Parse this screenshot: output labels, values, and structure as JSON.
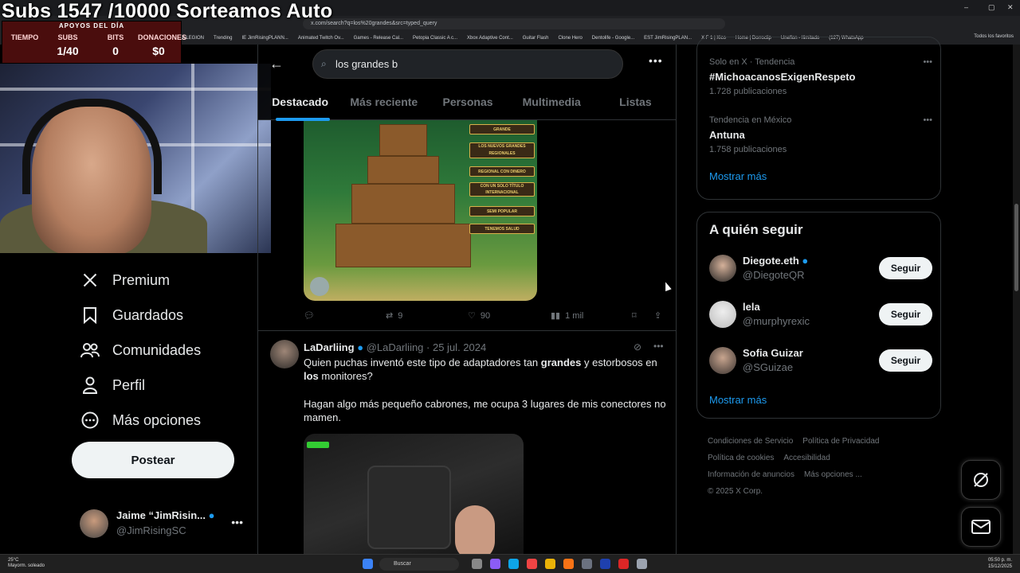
{
  "browser": {
    "url": "x.com/search?q=los%20grandes&src=typed_query",
    "bookmarks": [
      "A LEGION",
      "Trending",
      "IE JimRisingPLANN...",
      "Animated Twitch Ov...",
      "Games - Release Cal...",
      "Petopia Classic A c...",
      "Xbox Adaptive Cont...",
      "Guitar Flash",
      "Clone Hero",
      "Dentolife - Google...",
      "EST JimRisingPLAN...",
      "X F 1 | Xico",
      "Home | Dorroclip",
      "Uneflon - Ilimitado",
      "(127) WhatsApp"
    ],
    "all_bookmarks": "Todos los favoritos"
  },
  "overlay": {
    "title": "Subs 1547 /10000 Sorteamos Auto",
    "header": "APOYOS DEL DÍA",
    "counters": [
      {
        "label": "TIEMPO",
        "value": ""
      },
      {
        "label": "SUBS",
        "value": "1/40"
      },
      {
        "label": "BITS",
        "value": "0"
      },
      {
        "label": "DONACIONES",
        "value": "$0"
      }
    ]
  },
  "sidenav": {
    "items": [
      {
        "label": "Premium",
        "icon": "x-logo-icon"
      },
      {
        "label": "Guardados",
        "icon": "bookmark-icon"
      },
      {
        "label": "Comunidades",
        "icon": "communities-icon"
      },
      {
        "label": "Perfil",
        "icon": "person-icon"
      },
      {
        "label": "Más opciones",
        "icon": "more-circle-icon"
      }
    ],
    "post_label": "Postear",
    "account": {
      "name": "Jaime “JimRisin...",
      "handle": "@JimRisingSC"
    }
  },
  "search": {
    "value": "los grandes b",
    "tabs": [
      "Destacado",
      "Más reciente",
      "Personas",
      "Multimedia",
      "Listas"
    ],
    "active_tab": "Destacado"
  },
  "tweet1": {
    "image_labels": [
      "GRANDE",
      "LOS NUEVOS GRANDES REGIONALES",
      "REGIONAL CON DINERO",
      "CON UN SOLO TÍTULO INTERNACIONAL",
      "SEMI POPULAR",
      "TENEMOS SALUD"
    ],
    "replies": "",
    "retweets": "9",
    "likes": "90",
    "views": "1 mil"
  },
  "tweet2": {
    "name": "LaDarliing",
    "handle": "@LaDarliing",
    "date": "25 jul. 2024",
    "text_line1_a": "Quien puchas inventó este tipo de adaptadores tan ",
    "text_bold1": "grandes",
    "text_line1_b": " y estorbosos en ",
    "text_bold2": "los",
    "text_line1_c": " monitores?",
    "text_para2": "Hagan algo más pequeño cabrones, me ocupa 3 lugares de mis conectores no mamen."
  },
  "rail": {
    "trends": [
      {
        "meta": "Solo en X · Tendencia",
        "topic": "#MichoacanosExigenRespeto",
        "count": "1.728 publicaciones"
      },
      {
        "meta": "Tendencia en México",
        "topic": "Antuna",
        "count": "1.758 publicaciones"
      }
    ],
    "show_more": "Mostrar más",
    "who_to_follow_title": "A quién seguir",
    "follow": [
      {
        "name": "Diegote.eth",
        "handle": "@DiegoteQR",
        "button": "Seguir",
        "verified": true
      },
      {
        "name": "lela",
        "handle": "@murphyrexic",
        "button": "Seguir",
        "verified": false
      },
      {
        "name": "Sofia Guizar",
        "handle": "@SGuizae",
        "button": "Seguir",
        "verified": false
      }
    ],
    "show_more_2": "Mostrar más",
    "footer": [
      "Condiciones de Servicio",
      "Política de Privacidad",
      "Política de cookies",
      "Accesibilidad",
      "Información de anuncios",
      "Más opciones ...",
      "© 2025 X Corp."
    ]
  },
  "taskbar": {
    "weather_temp": "25°C",
    "weather_desc": "Mayorm. soleado",
    "search_placeholder": "Buscar",
    "time": "05:50 p. m.",
    "date": "15/12/2025"
  },
  "colors": {
    "accent": "#1d9bf0",
    "background": "#000000",
    "muted": "#71767b"
  }
}
